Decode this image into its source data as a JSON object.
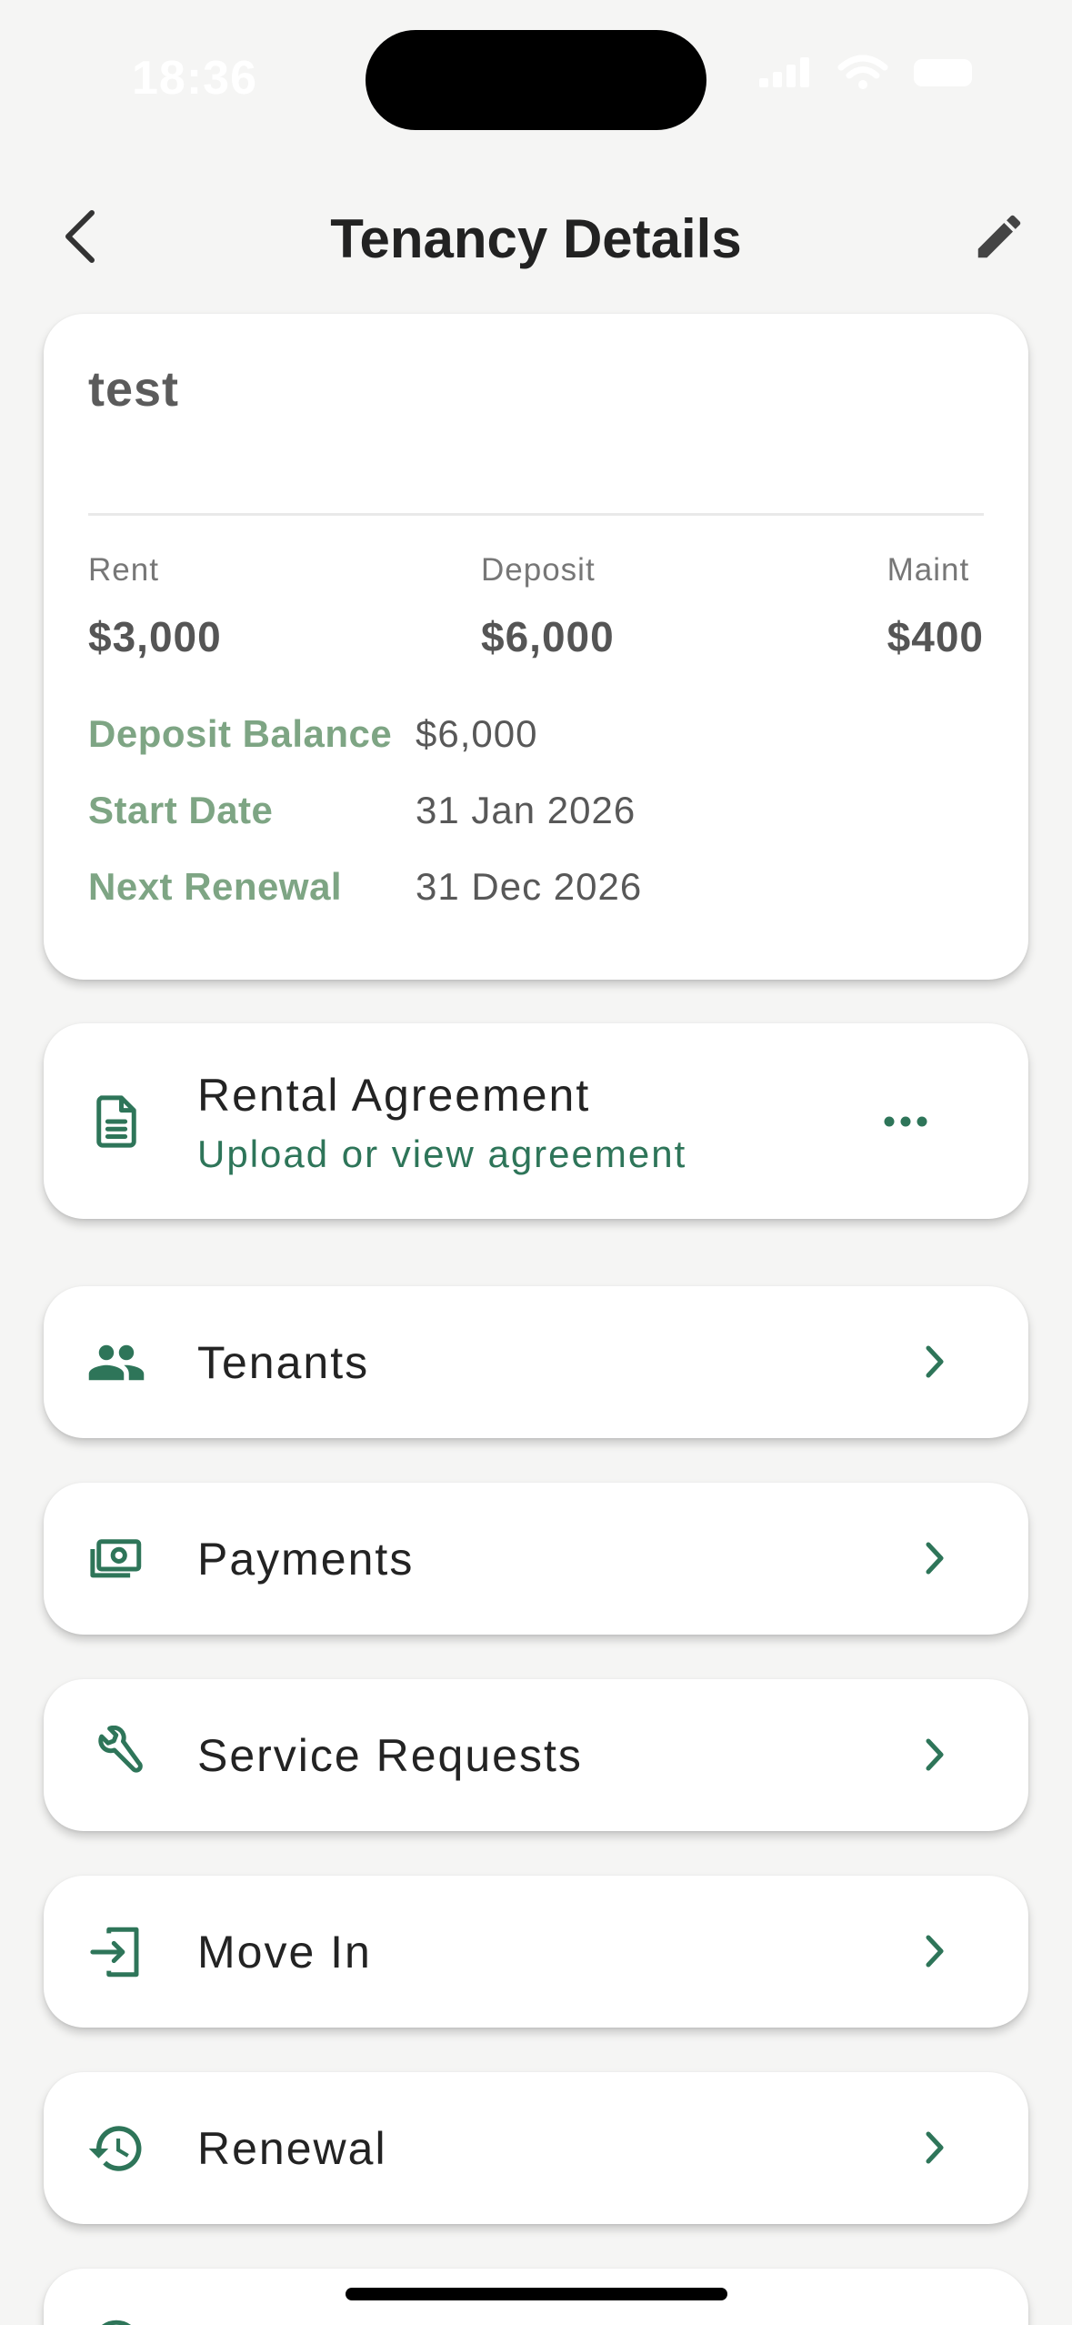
{
  "status_bar": {
    "time": "18:36"
  },
  "header": {
    "title": "Tenancy Details"
  },
  "summary": {
    "name": "test",
    "rent_label": "Rent",
    "rent_value": "$3,000",
    "deposit_label": "Deposit",
    "deposit_value": "$6,000",
    "maint_label": "Maint",
    "maint_value": "$400",
    "details": [
      {
        "label": "Deposit Balance",
        "value": "$6,000"
      },
      {
        "label": "Start Date",
        "value": "31 Jan 2026"
      },
      {
        "label": "Next Renewal",
        "value": "31 Dec 2026"
      }
    ]
  },
  "agreement": {
    "title": "Rental Agreement",
    "subtitle": "Upload or view agreement",
    "icon": "document-icon",
    "more_icon": "more-horizontal-icon"
  },
  "menu": [
    {
      "label": "Tenants",
      "icon": "people-icon"
    },
    {
      "label": "Payments",
      "icon": "money-icon"
    },
    {
      "label": "Service Requests",
      "icon": "wrench-icon"
    },
    {
      "label": "Move In",
      "icon": "login-icon"
    },
    {
      "label": "Renewal",
      "icon": "history-icon"
    }
  ],
  "colors": {
    "accent": "#2e7559",
    "label_green": "#7ea584",
    "background": "#f5f5f4",
    "card": "#ffffff"
  }
}
